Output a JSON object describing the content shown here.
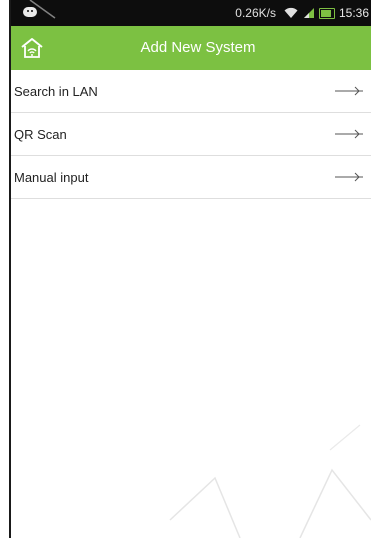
{
  "status_bar": {
    "speed": "0.26K/s",
    "time": "15:36"
  },
  "header": {
    "title": "Add New System",
    "home_icon": "home-wifi-icon"
  },
  "menu": {
    "items": [
      {
        "label": "Search in LAN",
        "icon": "chevron-right-icon"
      },
      {
        "label": "QR Scan",
        "icon": "chevron-right-icon"
      },
      {
        "label": "Manual input",
        "icon": "chevron-right-icon"
      }
    ]
  },
  "colors": {
    "accent": "#7cc142",
    "status_bar": "#0d0d0d",
    "divider": "#dedede"
  }
}
